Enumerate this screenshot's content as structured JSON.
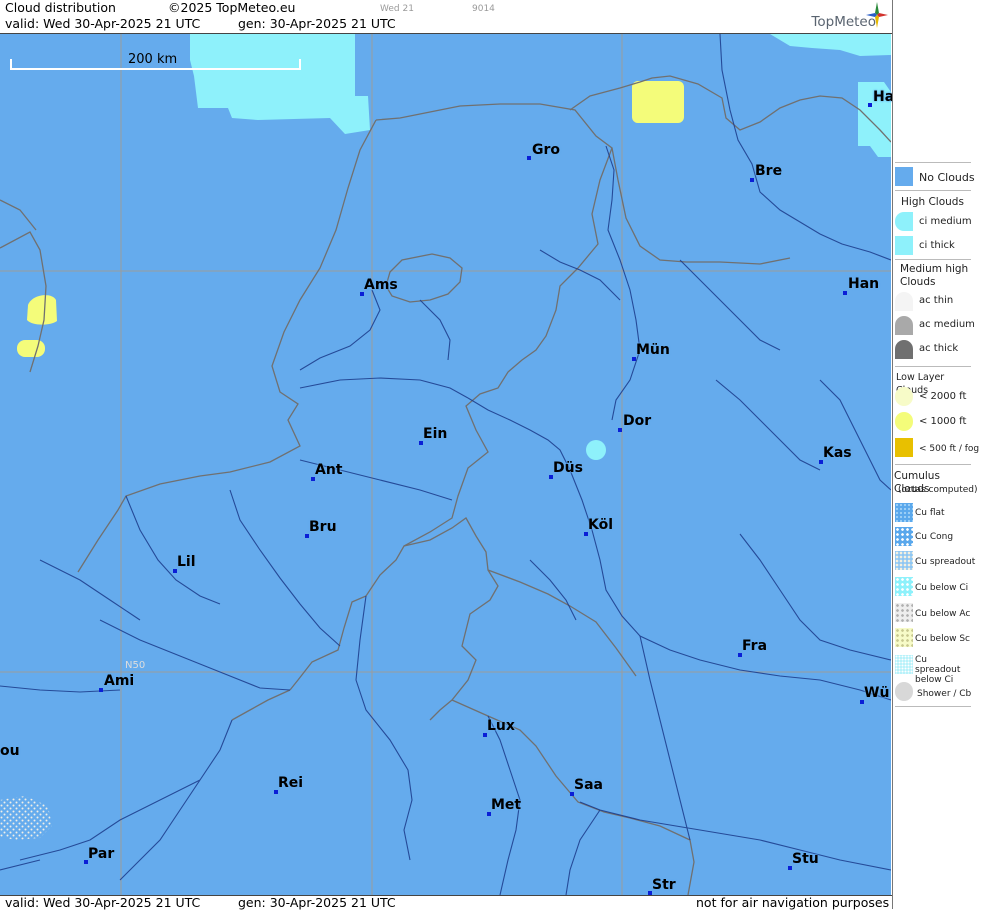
{
  "header": {
    "title": "Cloud distribution",
    "copyright": "©2025 TopMeteo.eu",
    "valid_line": "valid:  Wed  30-Apr-2025  21 UTC",
    "gen_line": "gen: 30-Apr-2025 21 UTC",
    "frame_label": "Wed 21",
    "frame_code": "9014",
    "brand": "TopMeteo"
  },
  "footer": {
    "valid_line": "valid:  Wed  30-Apr-2025  21 UTC",
    "gen_line": "gen: 30-Apr-2025 21 UTC",
    "disclaimer": "not for air navigation purposes"
  },
  "map": {
    "scale_label": "200 km",
    "graticule_label": "N50",
    "cities": [
      {
        "name": "Gro"
      },
      {
        "name": "Bre"
      },
      {
        "name": "Ha"
      },
      {
        "name": "Ams"
      },
      {
        "name": "Han"
      },
      {
        "name": "Mün"
      },
      {
        "name": "Dor"
      },
      {
        "name": "Ein"
      },
      {
        "name": "Düs"
      },
      {
        "name": "Kas"
      },
      {
        "name": "Ant"
      },
      {
        "name": "Bru"
      },
      {
        "name": "Köl"
      },
      {
        "name": "Lil"
      },
      {
        "name": "Fra"
      },
      {
        "name": "Ami"
      },
      {
        "name": "Wü"
      },
      {
        "name": "Lux"
      },
      {
        "name": "ou"
      },
      {
        "name": "Rei"
      },
      {
        "name": "Saa"
      },
      {
        "name": "Met"
      },
      {
        "name": "Par"
      },
      {
        "name": "Stu"
      },
      {
        "name": "Str"
      }
    ]
  },
  "legend": {
    "no_clouds": "No Clouds",
    "high_clouds": "High Clouds",
    "ci_medium": "ci medium",
    "ci_thick": "ci thick",
    "medium_high": "Medium high Clouds",
    "ac_thin": "ac thin",
    "ac_medium": "ac medium",
    "ac_thick": "ac thick",
    "low_layer": "Low Layer Clouds",
    "lt_2000": "< 2000 ft",
    "lt_1000": "< 1000 ft",
    "lt_500": "< 500 ft / fog",
    "cumulus": "Cumulus Clouds",
    "cumulus_sub": "(octas computed)",
    "cu_flat": "Cu flat",
    "cu_cong": "Cu Cong",
    "cu_spreadout": "Cu spreadout",
    "cu_below_ci": "Cu below Ci",
    "cu_below_ac": "Cu below Ac",
    "cu_below_sc": "Cu below Sc",
    "cu_spreadout_below_ci": "Cu spreadout below Ci",
    "shower_cb": "Shower / Cb"
  },
  "colors": {
    "no_clouds": "#65abed",
    "ci": "#8ef1fb",
    "low_1000": "#f4fc7a",
    "low_2000": "#f7fbc8",
    "fog": "#e8c000",
    "ac_medium": "#a9a9a9",
    "ac_thick": "#707070",
    "city_dot": "#0a1fd6"
  }
}
